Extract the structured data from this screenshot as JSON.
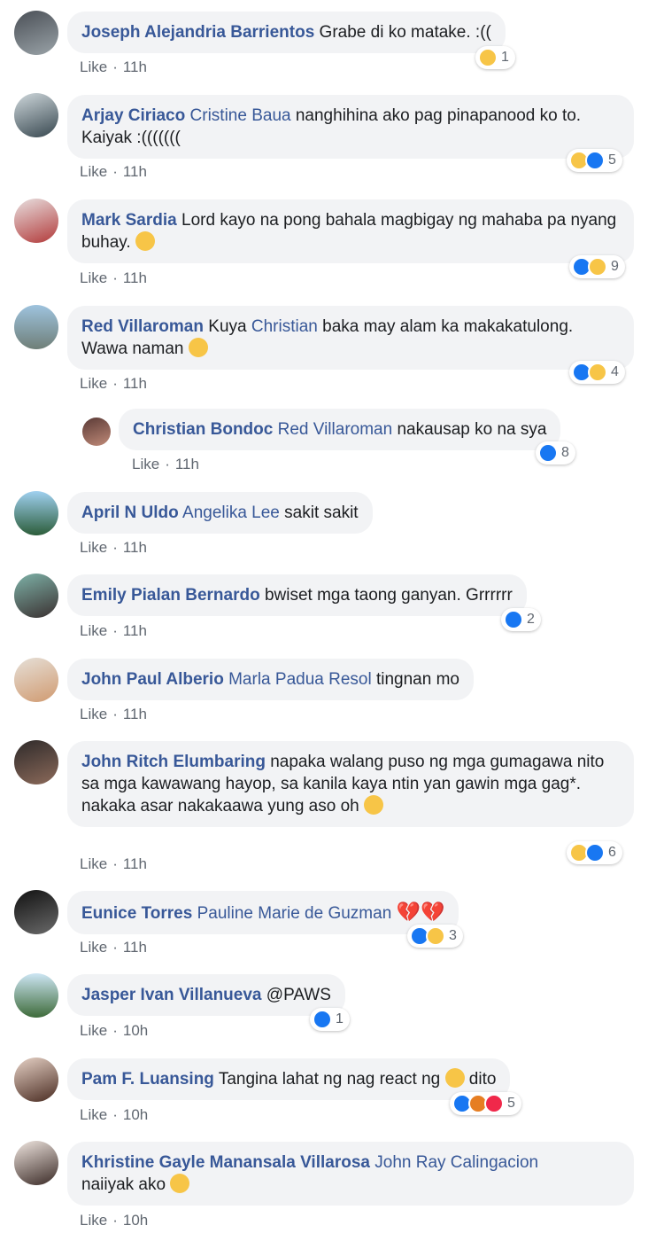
{
  "comments": [
    {
      "author": "Joseph Alejandria Barrientos",
      "tag": "",
      "text": "Grabe di ko matake. :((",
      "like": "Like",
      "time": "11h",
      "count": "1"
    },
    {
      "author": "Arjay Ciriaco",
      "tag": "Cristine Baua",
      "text": "nanghihina ako pag pinapanood ko to. Kaiyak :(((((((",
      "like": "Like",
      "time": "11h",
      "count": "5"
    },
    {
      "author": "Mark Sardia",
      "tag": "",
      "text": "Lord kayo na pong bahala magbigay ng mahaba pa nyang buhay.",
      "like": "Like",
      "time": "11h",
      "count": "9"
    },
    {
      "author": "Red Villaroman",
      "tag": "",
      "text_pre": "Kuya",
      "tag2": "Christian",
      "text": "baka may alam ka makakatulong. Wawa naman",
      "like": "Like",
      "time": "11h",
      "count": "4"
    },
    {
      "author": "Christian Bondoc",
      "tag": "Red Villaroman",
      "text": "nakausap ko na sya",
      "like": "Like",
      "time": "11h",
      "count": "8"
    },
    {
      "author": "April N Uldo",
      "tag": "Angelika Lee",
      "text": "sakit sakit",
      "like": "Like",
      "time": "11h",
      "count": ""
    },
    {
      "author": "Emily Pialan Bernardo",
      "tag": "",
      "text": "bwiset mga taong ganyan. Grrrrrr",
      "like": "Like",
      "time": "11h",
      "count": "2"
    },
    {
      "author": "John Paul Alberio",
      "tag": "Marla Padua Resol",
      "text": "tingnan mo",
      "like": "Like",
      "time": "11h",
      "count": ""
    },
    {
      "author": "John Ritch Elumbaring",
      "tag": "",
      "text": "napaka walang puso ng mga gumagawa nito sa mga kawawang hayop, sa kanila kaya ntin yan gawin mga gag*.",
      "text2": "nakaka asar nakakaawa yung aso oh",
      "like": "Like",
      "time": "11h",
      "count": "6"
    },
    {
      "author": "Eunice Torres",
      "tag": "Pauline Marie de Guzman",
      "text": "",
      "like": "Like",
      "time": "11h",
      "count": "3"
    },
    {
      "author": "Jasper Ivan Villanueva",
      "tag": "",
      "text": "@PAWS",
      "like": "Like",
      "time": "10h",
      "count": "1"
    },
    {
      "author": "Pam F. Luansing",
      "tag": "",
      "text": "Tangina lahat ng nag react ng",
      "text_post": "dito",
      "like": "Like",
      "time": "10h",
      "count": "5"
    },
    {
      "author": "Khristine Gayle Manansala Villarosa",
      "tag": "John Ray Calingacion",
      "text": "naiiyak ako",
      "like": "Like",
      "time": "10h",
      "count": ""
    }
  ],
  "colors": {
    "author": "#385898",
    "bubble": "#f2f3f5",
    "meta": "#606770",
    "like_reaction": "#1877f2",
    "sad_reaction": "#f7c547"
  }
}
